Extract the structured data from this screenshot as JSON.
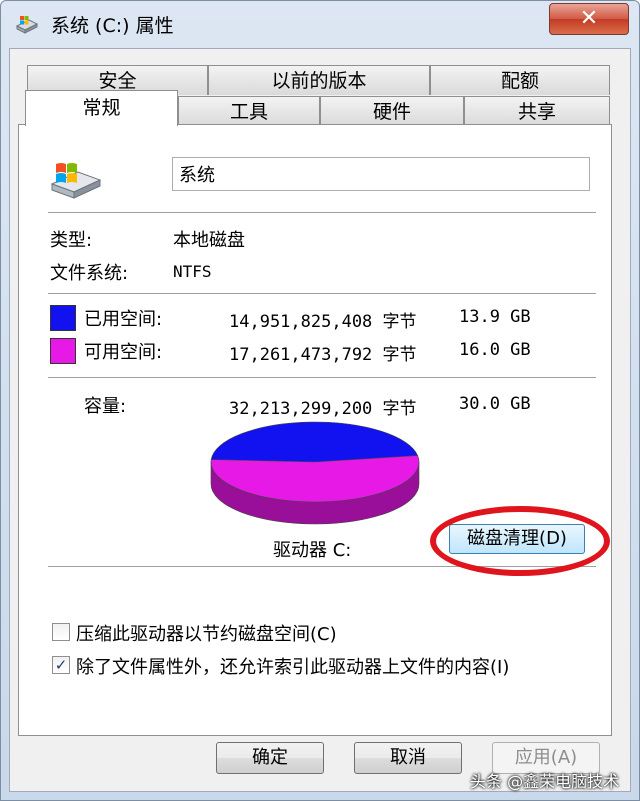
{
  "window": {
    "title": "系统 (C:) 属性",
    "close_glyph": "✕"
  },
  "tabs_back": [
    "安全",
    "以前的版本",
    "配额"
  ],
  "tabs_front": [
    "常规",
    "工具",
    "硬件",
    "共享"
  ],
  "general": {
    "volume_name": "系统",
    "type_label": "类型:",
    "type_value": "本地磁盘",
    "fs_label": "文件系统:",
    "fs_value": "NTFS",
    "used_label": "已用空间:",
    "used_bytes": "14,951,825,408 字节",
    "used_size": "13.9 GB",
    "free_label": "可用空间:",
    "free_bytes": "17,261,473,792 字节",
    "free_size": "16.0 GB",
    "capacity_label": "容量:",
    "capacity_bytes": "32,213,299,200 字节",
    "capacity_size": "30.0 GB",
    "drive_label": "驱动器 C:",
    "cleanup_button": "磁盘清理(D)",
    "compress_label": "压缩此驱动器以节约磁盘空间(C)",
    "compress_checked": false,
    "index_label": "除了文件属性外，还允许索引此驱动器上文件的内容(I)",
    "index_checked": true
  },
  "chart_data": {
    "type": "pie",
    "categories": [
      "已用空间",
      "可用空间"
    ],
    "values": [
      13.9,
      16.0
    ],
    "colors": [
      "#1212f0",
      "#e619e6"
    ]
  },
  "buttons": {
    "ok": "确定",
    "cancel": "取消",
    "apply": "应用(A)"
  },
  "watermark": "头条 @鑫荣电脑技术"
}
